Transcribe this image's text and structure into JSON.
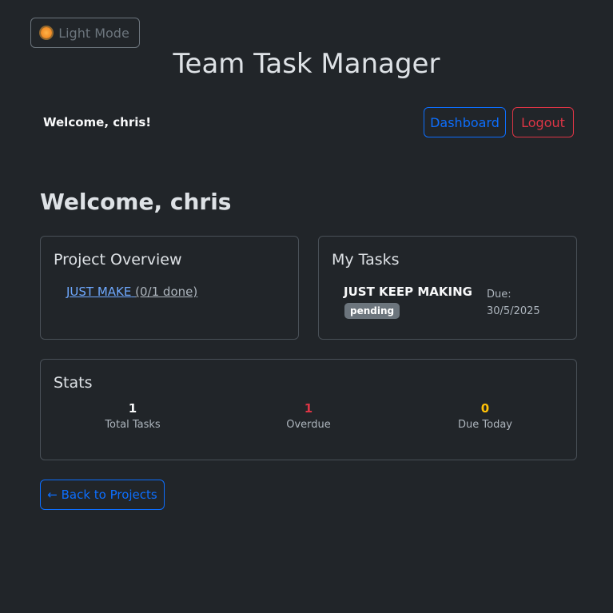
{
  "theme_toggle": {
    "label": "Light Mode",
    "icon": "sun-icon"
  },
  "header": {
    "title": "Team Task Manager",
    "welcome": "Welcome, chris!",
    "dashboard_label": "Dashboard",
    "logout_label": "Logout"
  },
  "main": {
    "heading": "Welcome, chris"
  },
  "project_overview": {
    "title": "Project Overview",
    "projects": [
      {
        "name": "JUST MAKE",
        "progress": "(0/1 done)"
      }
    ]
  },
  "my_tasks": {
    "title": "My Tasks",
    "tasks": [
      {
        "name": "JUST KEEP MAKING",
        "status": "pending",
        "due_label": "Due:",
        "due_date": "30/5/2025"
      }
    ]
  },
  "stats": {
    "title": "Stats",
    "items": [
      {
        "value": "1",
        "label": "Total Tasks",
        "color": "#f8f9fa"
      },
      {
        "value": "1",
        "label": "Overdue",
        "color": "#dc3545"
      },
      {
        "value": "0",
        "label": "Due Today",
        "color": "#ffc107"
      }
    ]
  },
  "back_button": {
    "label": "← Back to Projects"
  },
  "colors": {
    "primary": "#0d6efd",
    "danger": "#dc3545",
    "warning": "#ffc107",
    "background": "#212529"
  }
}
